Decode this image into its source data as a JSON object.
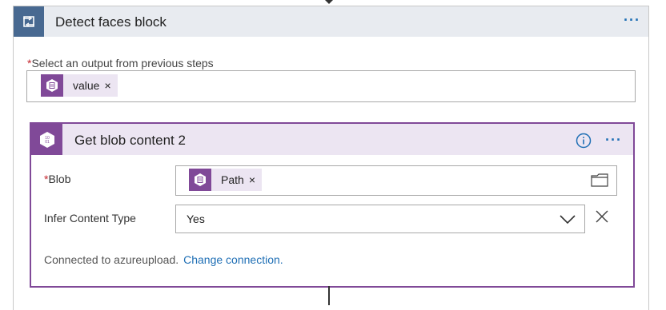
{
  "foreach": {
    "title": "Detect faces block",
    "menu_glyph": "···",
    "select_label": "Select an output from previous steps",
    "required_mark": "*",
    "token": {
      "label": "value",
      "close": "×"
    }
  },
  "action": {
    "title": "Get blob content 2",
    "menu_glyph": "···",
    "blob": {
      "label": "Blob",
      "required_mark": "*",
      "token": {
        "label": "Path",
        "close": "×"
      }
    },
    "infer": {
      "label": "Infer Content Type",
      "value": "Yes"
    },
    "connection": {
      "text": "Connected to azureupload.",
      "link": "Change connection."
    }
  },
  "colors": {
    "foreach_accent": "#486991",
    "action_accent": "#804998",
    "link": "#1f6fb5"
  },
  "icons": [
    "loop-icon",
    "blob-storage-icon",
    "info-icon",
    "folder-icon",
    "chevron-down-icon",
    "close-icon"
  ]
}
